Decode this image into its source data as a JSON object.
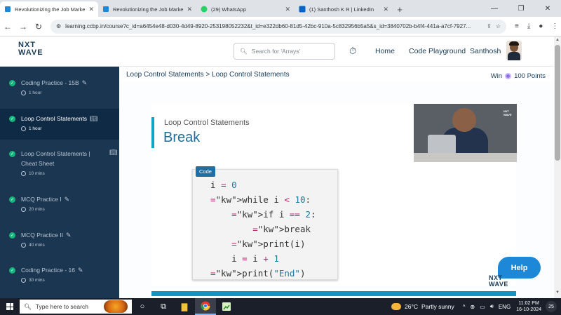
{
  "browser": {
    "tabs": [
      {
        "title": "Revolutionizing the Job Market",
        "icon": "ccbp-icon"
      },
      {
        "title": "Revolutionizing the Job Market",
        "icon": "ccbp-icon"
      },
      {
        "title": "(29) WhatsApp",
        "icon": "whatsapp-icon"
      },
      {
        "title": "(1) Santhosh K R | LinkedIn",
        "icon": "linkedin-icon"
      }
    ],
    "url": "learning.ccbp.in/course?c_id=a6454e48-d030-4d49-8920-253198052232&t_id=e322db60-81d5-42bc-910a-5c832956b5a5&s_id=3840702b-b4f4-441a-a7cf-7927..."
  },
  "header": {
    "logo_top": "NXT",
    "logo_bottom": "WAVE",
    "search_placeholder": "Search for 'Arrays'",
    "home": "Home",
    "playground": "Code Playground",
    "user": "Santhosh"
  },
  "sidebar": {
    "items": [
      {
        "title": "Coding Practice - 15B",
        "duration": "1 hour",
        "icon": "edit-icon"
      },
      {
        "title": "Loop Control Statements",
        "duration": "1 hour",
        "icon": "book-icon"
      },
      {
        "title": "Loop Control Statements | Cheat Sheet",
        "duration": "10 mins",
        "icon": "book-icon"
      },
      {
        "title": "MCQ Practice I",
        "duration": "20 mins",
        "icon": "edit-icon"
      },
      {
        "title": "MCQ Practice II",
        "duration": "40 mins",
        "icon": "edit-icon"
      },
      {
        "title": "Coding Practice - 16",
        "duration": "30 mins",
        "icon": "edit-icon"
      }
    ]
  },
  "main": {
    "breadcrumb": "Loop Control Statements > Loop Control Statements",
    "win_label": "Win",
    "points": "100 Points",
    "slide_subtitle": "Loop Control Statements",
    "slide_title": "Break",
    "code_label": "Code",
    "code_lines": [
      "i = 0",
      "while i < 10:",
      "    if i == 2:",
      "        break",
      "    print(i)",
      "    i = i + 1",
      "print(\"End\")"
    ],
    "help": "Help",
    "watermark_top": "NXT",
    "watermark_bottom": "WAVE"
  },
  "taskbar": {
    "search_placeholder": "Type here to search",
    "temperature": "26°C",
    "weather": "Partly sunny",
    "lang": "ENG",
    "time": "11:02 PM",
    "date": "16-10-2024",
    "notifications": "25"
  }
}
